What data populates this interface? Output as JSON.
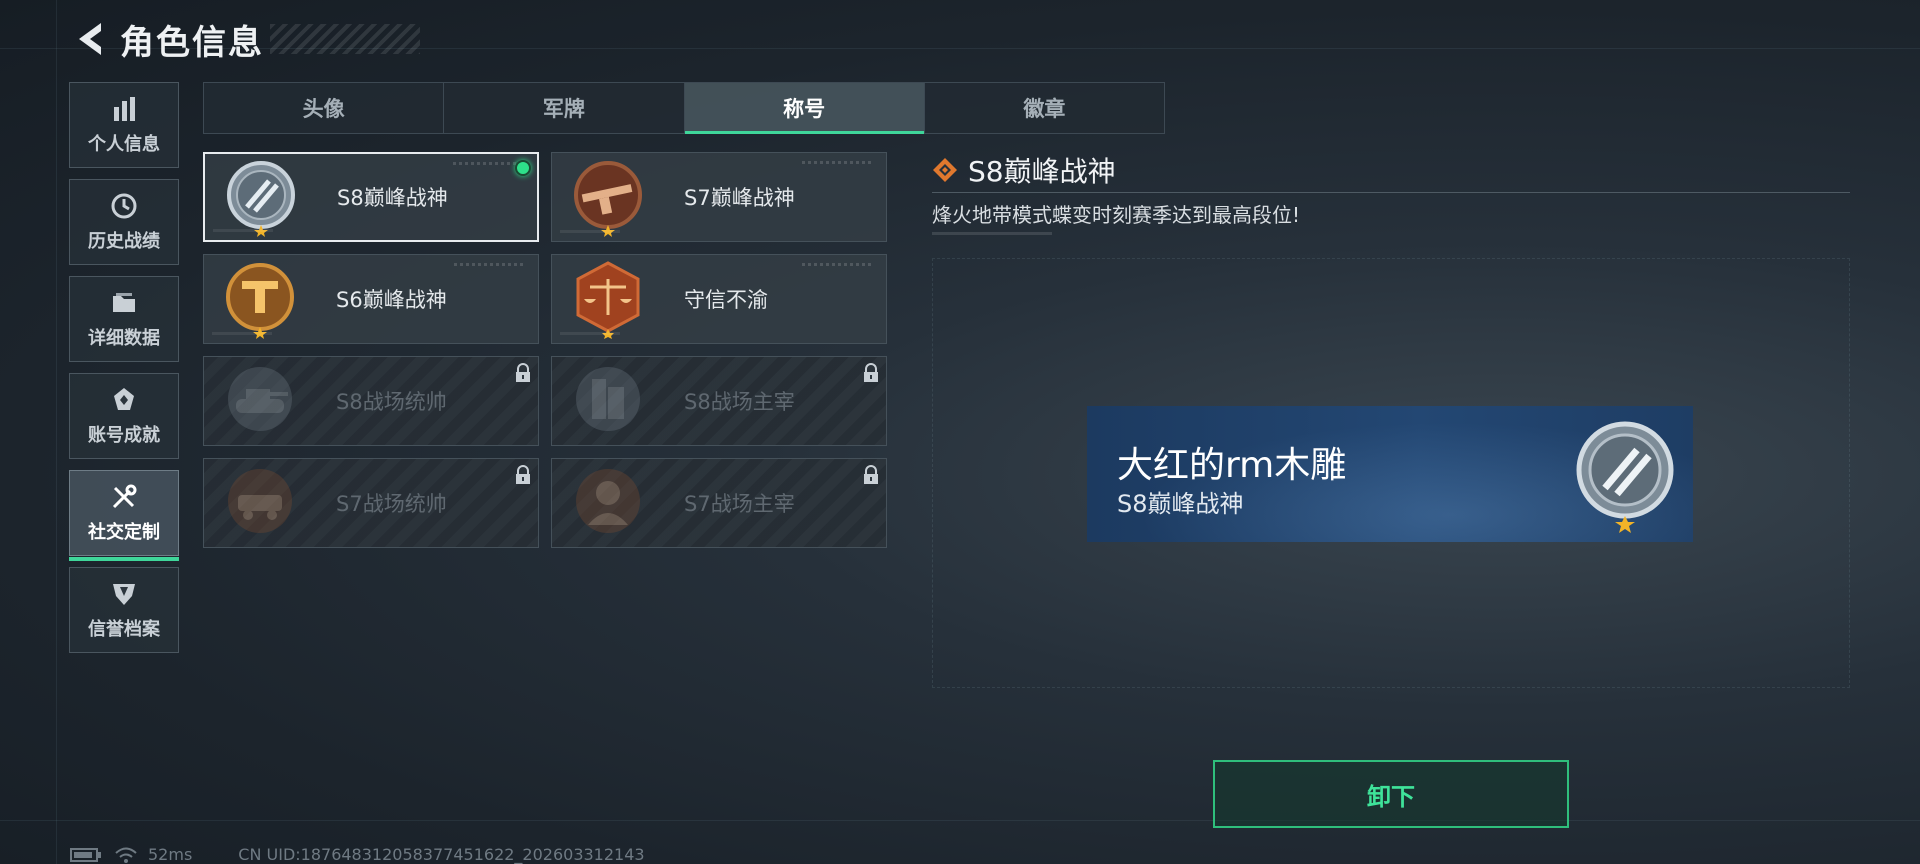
{
  "header": {
    "title": "角色信息"
  },
  "nav": {
    "items": [
      {
        "label": "个人信息",
        "icon": "bar-chart-icon"
      },
      {
        "label": "历史战绩",
        "icon": "history-clock-icon"
      },
      {
        "label": "详细数据",
        "icon": "folder-icon"
      },
      {
        "label": "账号成就",
        "icon": "achievement-icon"
      },
      {
        "label": "社交定制",
        "icon": "tools-icon",
        "active": true
      },
      {
        "label": "信誉档案",
        "icon": "shield-emblem-icon"
      }
    ]
  },
  "tabs": [
    {
      "label": "头像"
    },
    {
      "label": "军牌"
    },
    {
      "label": "称号",
      "active": true
    },
    {
      "label": "徽章"
    }
  ],
  "titles": [
    {
      "label": "S8巅峰战神",
      "state": "equipped",
      "medal": "silver-stripes-medal"
    },
    {
      "label": "S7巅峰战神",
      "state": "owned",
      "medal": "bronze-rifle-medal"
    },
    {
      "label": "S6巅峰战神",
      "state": "owned",
      "medal": "gold-t-medal"
    },
    {
      "label": "守信不渝",
      "state": "owned",
      "medal": "scales-medal"
    },
    {
      "label": "S8战场统帅",
      "state": "locked",
      "medal": "tank-medal"
    },
    {
      "label": "S8战场主宰",
      "state": "locked",
      "medal": "building-medal"
    },
    {
      "label": "S7战场统帅",
      "state": "locked",
      "medal": "vehicle-medal"
    },
    {
      "label": "S7战场主宰",
      "state": "locked",
      "medal": "soldier-medal"
    }
  ],
  "detail": {
    "title": "S8巅峰战神",
    "description": "烽火地带模式蝶变时刻赛季达到最高段位!"
  },
  "nameplate": {
    "player_name": "大红的rm木雕",
    "title": "S8巅峰战神"
  },
  "actions": {
    "unequip_label": "卸下"
  },
  "status": {
    "ping": "52ms",
    "uid": "CN UID:1876483120583774516​22_202603312143"
  },
  "colors": {
    "accent": "#3fd69a",
    "equipped": "#2ee08a"
  }
}
